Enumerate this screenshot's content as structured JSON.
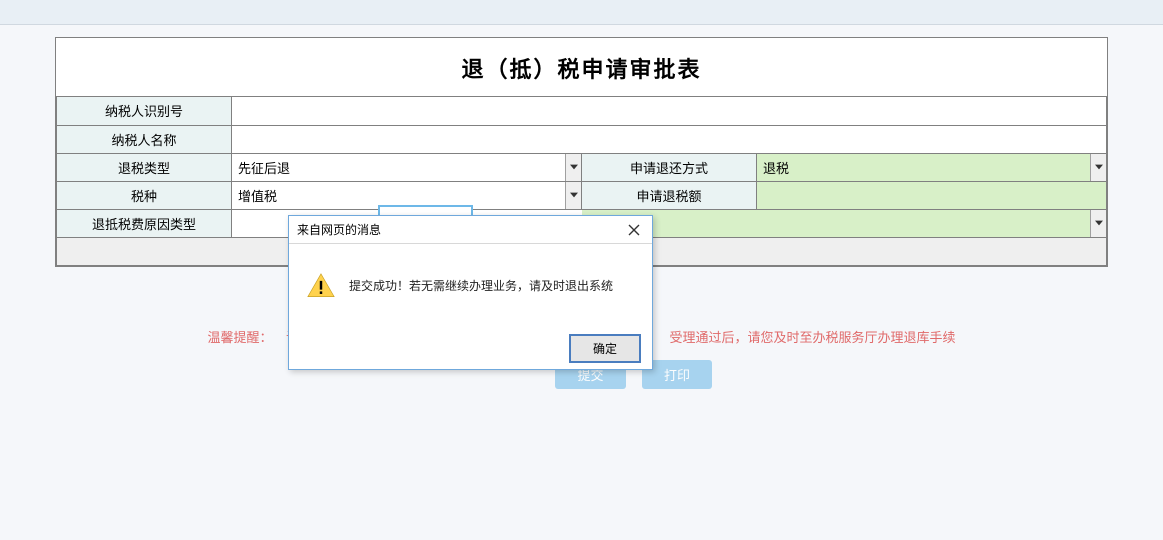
{
  "form": {
    "title": "退（抵）税申请审批表",
    "taxpayer_id_label": "纳税人识别号",
    "taxpayer_id_value": "",
    "taxpayer_name_label": "纳税人名称",
    "taxpayer_name_value": "",
    "refund_type_label": "退税类型",
    "refund_type_value": "先征后退",
    "return_method_label": "申请退还方式",
    "return_method_value": "退税",
    "tax_category_label": "税种",
    "tax_category_value": "增值税",
    "refund_amount_label": "申请退税额",
    "refund_amount_value": "",
    "refund_reason_label": "退抵税费原因类型",
    "refund_reason_value": ""
  },
  "hint": {
    "label": "温馨提醒：",
    "text_left": "请您",
    "text_right": "受理通过后，请您及时至办税服务厅办理退库手续"
  },
  "buttons": {
    "submit": "提交",
    "print": "打印"
  },
  "modal": {
    "header": "来自网页的消息",
    "message": "提交成功！若无需继续办理业务，请及时退出系统",
    "ok": "确定"
  }
}
